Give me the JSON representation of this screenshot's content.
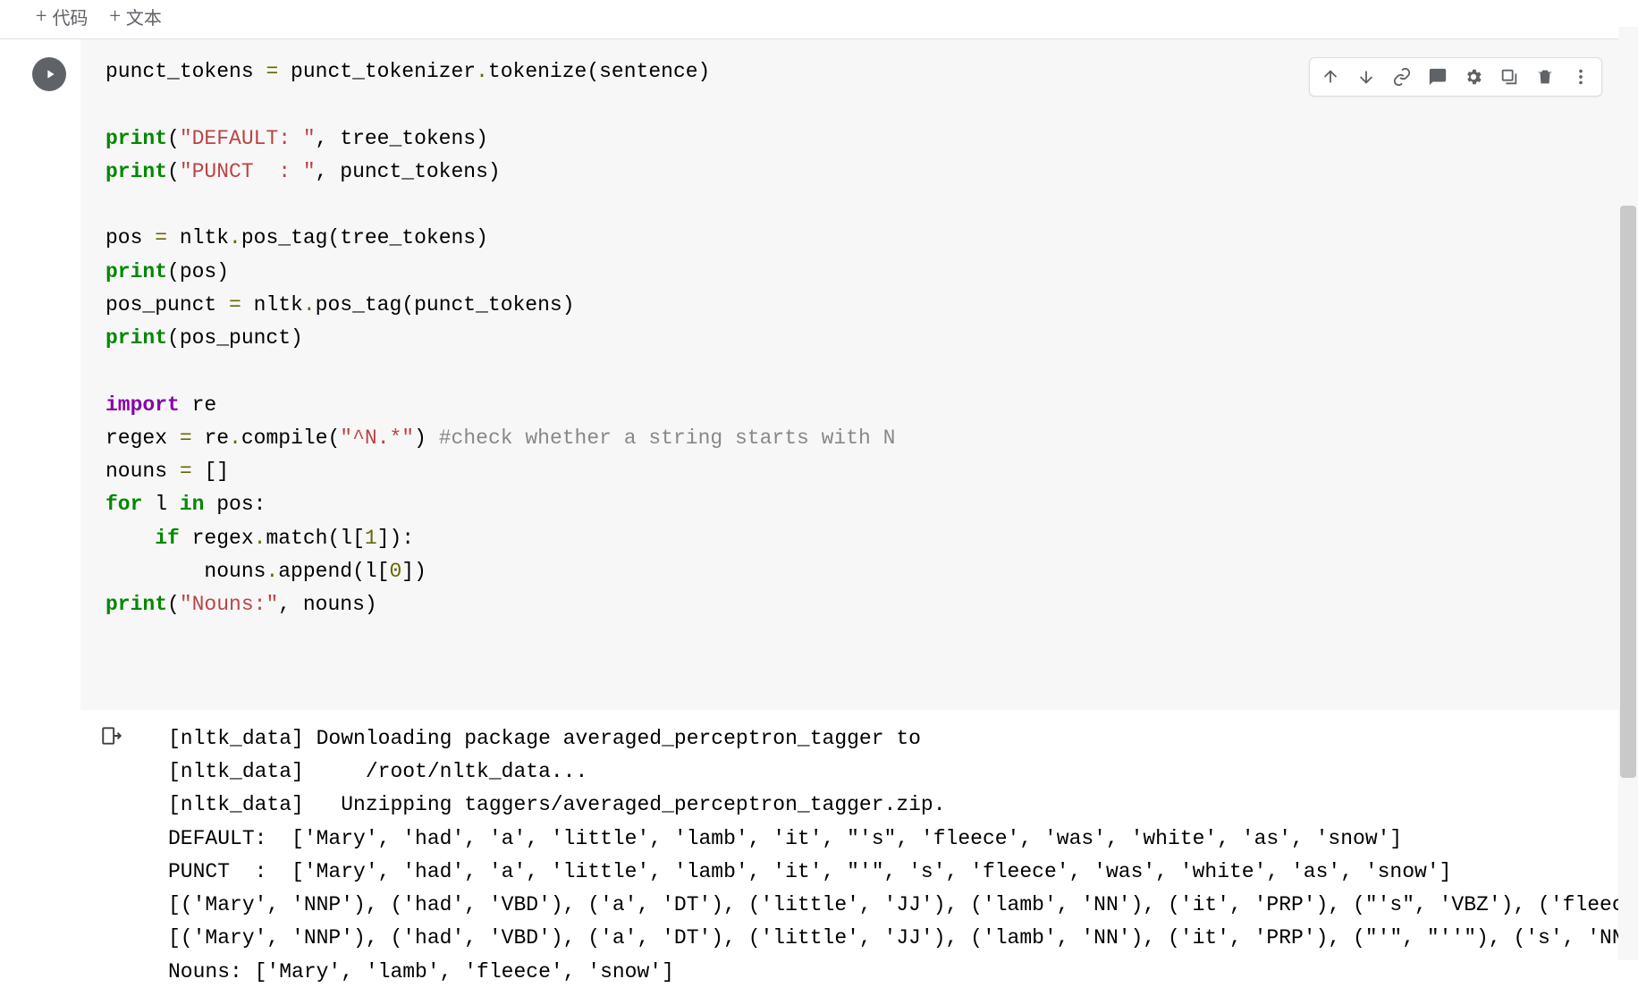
{
  "toolbar": {
    "code_label": "代码",
    "text_label": "文本"
  },
  "code": {
    "l1_a": "punct_tokens ",
    "l1_b": "=",
    "l1_c": " punct_tokenizer",
    "l1_d": ".",
    "l1_e": "tokenize(sentence)",
    "l3_a": "print",
    "l3_b": "(",
    "l3_c": "\"DEFAULT: \"",
    "l3_d": ", tree_tokens)",
    "l4_a": "print",
    "l4_b": "(",
    "l4_c": "\"PUNCT  : \"",
    "l4_d": ", punct_tokens)",
    "l6_a": "pos ",
    "l6_b": "=",
    "l6_c": " nltk",
    "l6_d": ".",
    "l6_e": "pos_tag(tree_tokens)",
    "l7_a": "print",
    "l7_b": "(pos)",
    "l8_a": "pos_punct ",
    "l8_b": "=",
    "l8_c": " nltk",
    "l8_d": ".",
    "l8_e": "pos_tag(punct_tokens)",
    "l9_a": "print",
    "l9_b": "(pos_punct)",
    "l11_a": "import",
    "l11_b": " re",
    "l12_a": "regex ",
    "l12_b": "=",
    "l12_c": " re",
    "l12_d": ".",
    "l12_e": "compile(",
    "l12_f": "\"^N.*\"",
    "l12_g": ") ",
    "l12_h": "#check whether a string starts with N",
    "l13_a": "nouns ",
    "l13_b": "=",
    "l13_c": " []",
    "l14_a": "for",
    "l14_b": " l ",
    "l14_c": "in",
    "l14_d": " pos:",
    "l15_a": "    ",
    "l15_b": "if",
    "l15_c": " regex",
    "l15_d": ".",
    "l15_e": "match(l[",
    "l15_f": "1",
    "l15_g": "]):",
    "l16_a": "        nouns",
    "l16_b": ".",
    "l16_c": "append(l[",
    "l16_d": "0",
    "l16_e": "])",
    "l17_a": "print",
    "l17_b": "(",
    "l17_c": "\"Nouns:\"",
    "l17_d": ", nouns)"
  },
  "output": {
    "text": "[nltk_data] Downloading package averaged_perceptron_tagger to\n[nltk_data]     /root/nltk_data...\n[nltk_data]   Unzipping taggers/averaged_perceptron_tagger.zip.\nDEFAULT:  ['Mary', 'had', 'a', 'little', 'lamb', 'it', \"'s\", 'fleece', 'was', 'white', 'as', 'snow']\nPUNCT  :  ['Mary', 'had', 'a', 'little', 'lamb', 'it', \"'\", 's', 'fleece', 'was', 'white', 'as', 'snow']\n[('Mary', 'NNP'), ('had', 'VBD'), ('a', 'DT'), ('little', 'JJ'), ('lamb', 'NN'), ('it', 'PRP'), (\"'s\", 'VBZ'), ('fleece', 'NN'), ('was', 'VBD'), ('white', 'JJ')]\n[('Mary', 'NNP'), ('had', 'VBD'), ('a', 'DT'), ('little', 'JJ'), ('lamb', 'NN'), ('it', 'PRP'), (\"'\", \"''\"), ('s', 'NN'), ('fleece', 'NN'), ('was', 'VBD')]\nNouns: ['Mary', 'lamb', 'fleece', 'snow']"
  }
}
